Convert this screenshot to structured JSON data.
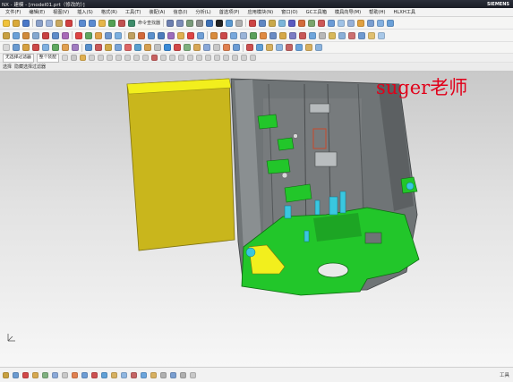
{
  "window": {
    "title": "NX - 建模 - [model01.prt（修改的）]",
    "brand": "SIEMENS"
  },
  "menubar": {
    "items": [
      "文件(F)",
      "编辑(E)",
      "视图(V)",
      "插入(S)",
      "格式(R)",
      "工具(T)",
      "装配(A)",
      "信息(I)",
      "分析(L)",
      "首选项(P)",
      "应用模块(N)",
      "窗口(O)",
      "GC工具箱",
      "模具向导(M)",
      "帮助(H)",
      "HLXH工具"
    ]
  },
  "toolbar1": {
    "buttons_text": "命令查找器"
  },
  "toolbar4": {
    "filter_label": "无选择过滤器",
    "scope_label": "整个装配"
  },
  "toolbar5": {
    "selection_label": "选择",
    "hint_label": "隐藏选择过滤器"
  },
  "viewport": {
    "watermark_text": "suger老师"
  },
  "statusbar": {
    "right_text": "工具"
  },
  "colors": {
    "viewport_top": "#c9c9c9",
    "viewport_bottom": "#f7f7f7",
    "part_yellow": "#c9b61c",
    "part_green": "#22c62a",
    "part_grey": "#6f7476",
    "part_cyan": "#39c7e0",
    "watermark_red": "#e1001a"
  }
}
